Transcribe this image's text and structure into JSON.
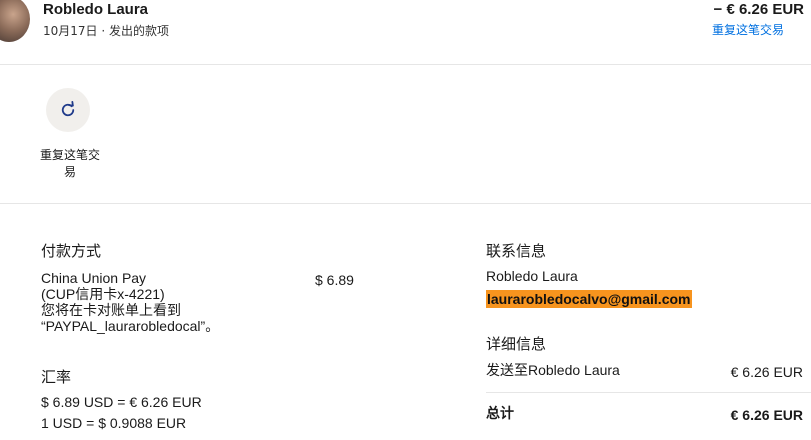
{
  "header": {
    "name": "Robledo Laura",
    "date": "10月17日",
    "separator": "·",
    "type": "发出的款项",
    "amount": "− € 6.26 EUR",
    "repeat_link": "重复这笔交易"
  },
  "actions": {
    "repeat_label": "重复这笔交易"
  },
  "payment": {
    "title": "付款方式",
    "method_lines": [
      "China Union Pay",
      "(CUP信用卡x-4221)",
      "您将在卡对账单上看到",
      "“PAYPAL_laurarobledocal”。"
    ],
    "amount": "$ 6.89"
  },
  "exchange": {
    "title": "汇率",
    "line1": "$ 6.89 USD = € 6.26 EUR",
    "line2": "1 USD = $ 0.9088 EUR"
  },
  "contact": {
    "title": "联系信息",
    "name": "Robledo Laura",
    "email": "laurarobledocalvo@gmail.com",
    "highlight_color": "#f7941e"
  },
  "details": {
    "title": "详细信息",
    "sent_to_label": "发送至Robledo Laura",
    "sent_to_amount": "€ 6.26 EUR",
    "total_label": "总计",
    "total_amount": "€ 6.26 EUR"
  },
  "colors": {
    "link": "#0070e0",
    "icon": "#1f3a8a"
  }
}
